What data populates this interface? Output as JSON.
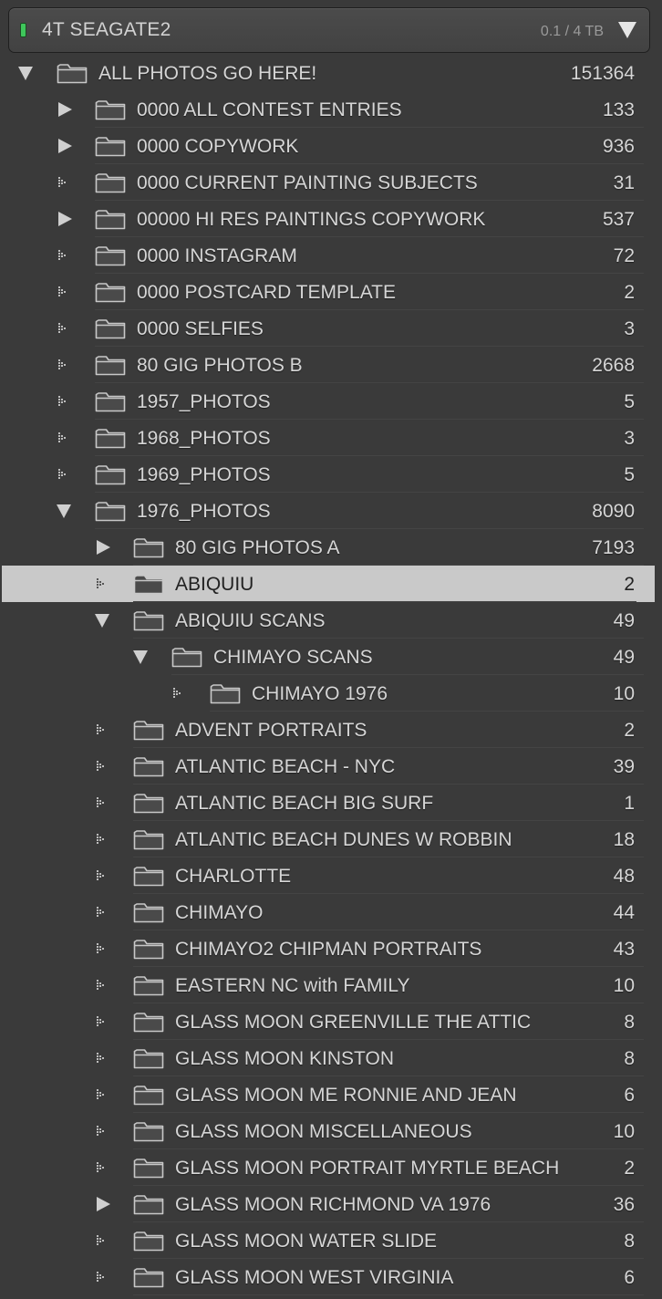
{
  "volume": {
    "name": "4T SEAGATE2",
    "size": "0.1 / 4 TB",
    "status_color": "#3fc75b"
  },
  "folders": [
    {
      "label": "ALL PHOTOS GO HERE!",
      "count": "151364",
      "depth": 0,
      "state": "expanded"
    },
    {
      "label": "0000 ALL CONTEST ENTRIES",
      "count": "133",
      "depth": 1,
      "state": "collapsed"
    },
    {
      "label": "0000 COPYWORK",
      "count": "936",
      "depth": 1,
      "state": "collapsed"
    },
    {
      "label": "0000 CURRENT PAINTING SUBJECTS",
      "count": "31",
      "depth": 1,
      "state": "leaf"
    },
    {
      "label": "00000 HI RES PAINTINGS COPYWORK",
      "count": "537",
      "depth": 1,
      "state": "collapsed"
    },
    {
      "label": "0000 INSTAGRAM",
      "count": "72",
      "depth": 1,
      "state": "leaf"
    },
    {
      "label": "0000 POSTCARD TEMPLATE",
      "count": "2",
      "depth": 1,
      "state": "leaf"
    },
    {
      "label": "0000 SELFIES",
      "count": "3",
      "depth": 1,
      "state": "leaf"
    },
    {
      "label": "80 GIG PHOTOS B",
      "count": "2668",
      "depth": 1,
      "state": "leaf"
    },
    {
      "label": "1957_PHOTOS",
      "count": "5",
      "depth": 1,
      "state": "leaf"
    },
    {
      "label": "1968_PHOTOS",
      "count": "3",
      "depth": 1,
      "state": "leaf"
    },
    {
      "label": "1969_PHOTOS",
      "count": "5",
      "depth": 1,
      "state": "leaf"
    },
    {
      "label": "1976_PHOTOS",
      "count": "8090",
      "depth": 1,
      "state": "expanded"
    },
    {
      "label": "80 GIG PHOTOS A",
      "count": "7193",
      "depth": 2,
      "state": "collapsed"
    },
    {
      "label": "ABIQUIU",
      "count": "2",
      "depth": 2,
      "state": "leaf",
      "selected": true
    },
    {
      "label": "ABIQUIU SCANS",
      "count": "49",
      "depth": 2,
      "state": "expanded"
    },
    {
      "label": "CHIMAYO SCANS",
      "count": "49",
      "depth": 3,
      "state": "expanded"
    },
    {
      "label": "CHIMAYO 1976",
      "count": "10",
      "depth": 4,
      "state": "leaf"
    },
    {
      "label": "ADVENT PORTRAITS",
      "count": "2",
      "depth": 2,
      "state": "leaf"
    },
    {
      "label": "ATLANTIC BEACH - NYC",
      "count": "39",
      "depth": 2,
      "state": "leaf"
    },
    {
      "label": "ATLANTIC BEACH BIG SURF",
      "count": "1",
      "depth": 2,
      "state": "leaf"
    },
    {
      "label": "ATLANTIC BEACH DUNES W ROBBIN",
      "count": "18",
      "depth": 2,
      "state": "leaf"
    },
    {
      "label": "CHARLOTTE",
      "count": "48",
      "depth": 2,
      "state": "leaf"
    },
    {
      "label": "CHIMAYO",
      "count": "44",
      "depth": 2,
      "state": "leaf"
    },
    {
      "label": "CHIMAYO2 CHIPMAN PORTRAITS",
      "count": "43",
      "depth": 2,
      "state": "leaf"
    },
    {
      "label": "EASTERN NC with FAMILY",
      "count": "10",
      "depth": 2,
      "state": "leaf"
    },
    {
      "label": "GLASS MOON GREENVILLE THE ATTIC",
      "count": "8",
      "depth": 2,
      "state": "leaf"
    },
    {
      "label": "GLASS MOON KINSTON",
      "count": "8",
      "depth": 2,
      "state": "leaf"
    },
    {
      "label": "GLASS MOON ME RONNIE AND JEAN",
      "count": "6",
      "depth": 2,
      "state": "leaf"
    },
    {
      "label": "GLASS MOON MISCELLANEOUS",
      "count": "10",
      "depth": 2,
      "state": "leaf"
    },
    {
      "label": "GLASS MOON PORTRAIT MYRTLE BEACH",
      "count": "2",
      "depth": 2,
      "state": "leaf"
    },
    {
      "label": "GLASS MOON RICHMOND VA 1976",
      "count": "36",
      "depth": 2,
      "state": "collapsed"
    },
    {
      "label": "GLASS MOON WATER SLIDE",
      "count": "8",
      "depth": 2,
      "state": "leaf"
    },
    {
      "label": "GLASS MOON WEST VIRGINIA",
      "count": "6",
      "depth": 2,
      "state": "leaf"
    }
  ]
}
